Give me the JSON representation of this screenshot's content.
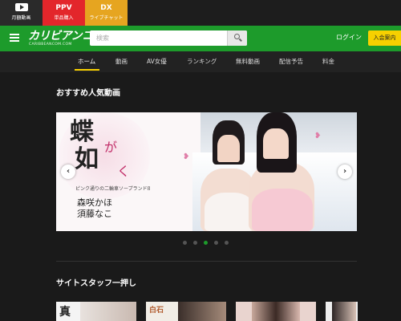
{
  "top_categories": [
    {
      "glyph": "",
      "label": "月額動画",
      "icon": "play-icon",
      "color": "#2a2a2a"
    },
    {
      "glyph": "PPV",
      "label": "単品購入",
      "icon": "",
      "color": "#e3262b"
    },
    {
      "glyph": "DX",
      "label": "ライブチャット",
      "icon": "",
      "color": "#e6a520"
    }
  ],
  "header": {
    "logo": "カリビアンコム",
    "logo_sub": "CARIBBEANCOM.COM",
    "search_placeholder": "検索",
    "login_label": "ログイン",
    "join_label": "入会案内",
    "accent_color": "#1d9b2b",
    "join_color": "#f7d000"
  },
  "nav": {
    "tabs": [
      "ホーム",
      "動画",
      "AV女優",
      "ランキング",
      "無料動画",
      "配信予告",
      "料金"
    ],
    "active_index": 0
  },
  "sections": {
    "recommended_title": "おすすめ人気動画",
    "staff_pick_title": "サイトスタッフ一押し"
  },
  "banner": {
    "title_line1": "蝶",
    "title_ga": "が",
    "title_line2": "如",
    "title_ku": "く",
    "subtitle": "ピンク通りの二輪車ソープランド8",
    "star1": "森咲かほ",
    "star2": "須藤なこ"
  },
  "carousel": {
    "slide_count": 5,
    "active_slide": 2
  },
  "staff_thumbs": [
    {
      "text": "真"
    },
    {
      "text": "白石"
    },
    {
      "text": ""
    },
    {
      "text": ""
    }
  ]
}
